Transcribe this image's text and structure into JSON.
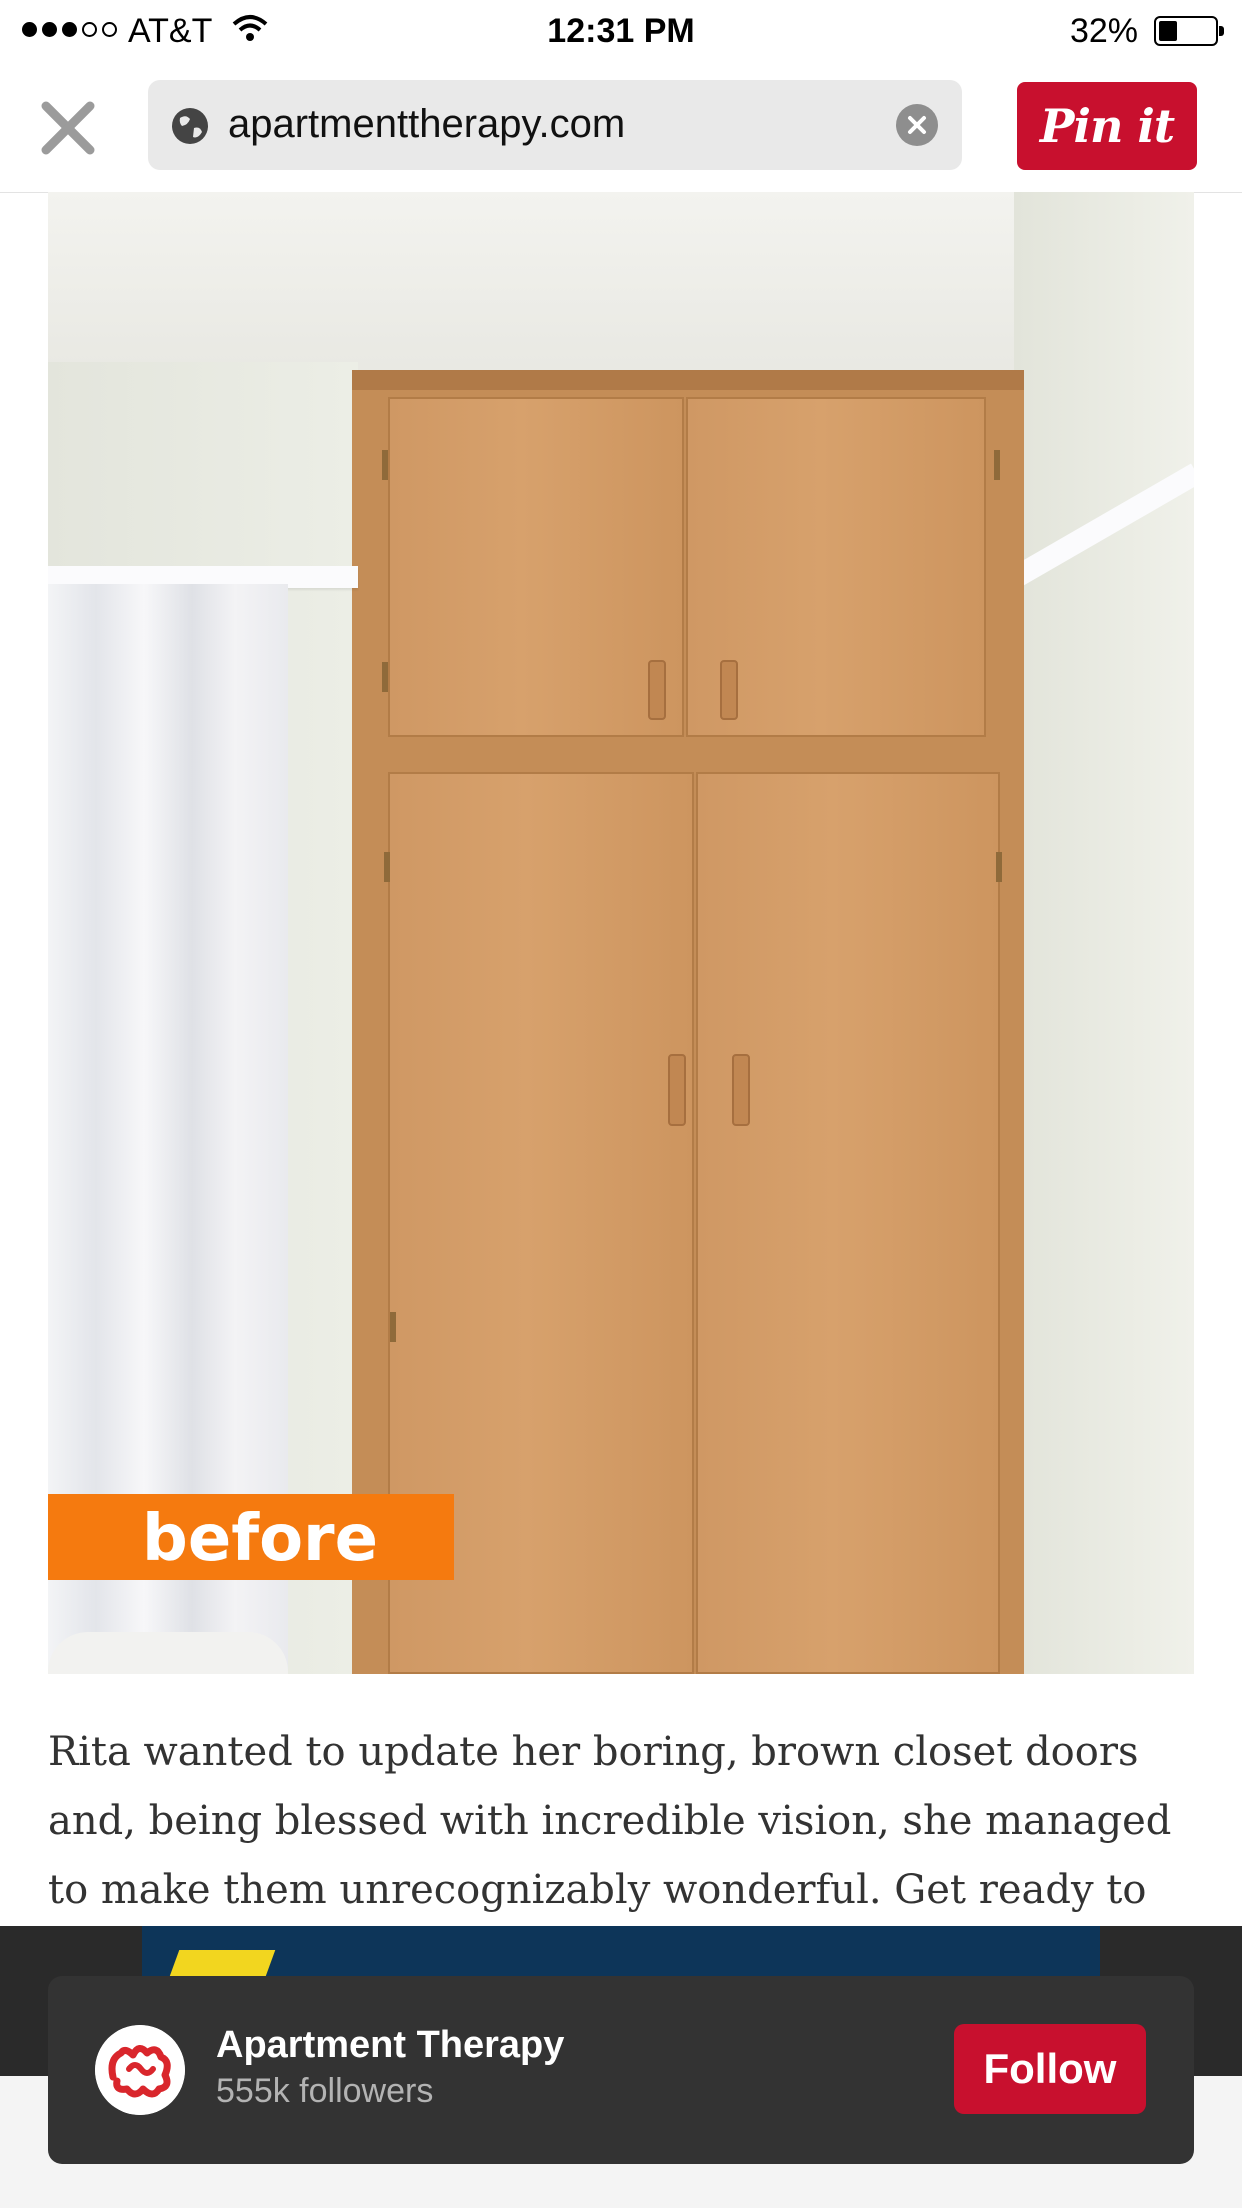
{
  "status_bar": {
    "carrier": "AT&T",
    "time": "12:31 PM",
    "battery_percent": "32%",
    "signal_strength": 3,
    "signal_max": 5
  },
  "browser": {
    "url": "apartmenttherapy.com",
    "close_icon": "close-icon",
    "globe_icon": "globe-icon",
    "clear_icon": "clear-icon",
    "pin_button_label": "Pin it"
  },
  "pin": {
    "image_label": "before",
    "description": "Rita wanted to update her boring, brown closet doors and, being blessed with incredible vision, she managed to make them unrecognizably wonderful. Get ready to pick"
  },
  "follow_card": {
    "account_name": "Apartment Therapy",
    "followers": "555k followers",
    "follow_label": "Follow"
  },
  "colors": {
    "pinterest_red": "#c8102e",
    "label_orange": "#f57a0f",
    "overlay_dark": "#333333"
  }
}
